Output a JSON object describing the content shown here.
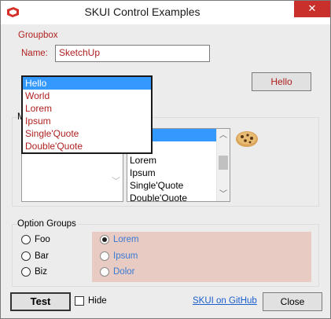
{
  "window": {
    "title": "SKUI Control Examples",
    "close_glyph": "✕",
    "app_icon": "sketchup-icon"
  },
  "groupbox": {
    "label": "Groupbox",
    "name_label": "Name:",
    "name_value": "SketchUp",
    "hello_button": "Hello"
  },
  "dropdown": {
    "options": [
      "Hello",
      "World",
      "Lorem",
      "Ipsum",
      "Single'Quote",
      "Double'Quote"
    ],
    "selected": "Hello"
  },
  "listbox_group": {
    "label": "M",
    "right_list": {
      "items": [
        "",
        "",
        "Lorem",
        "Ipsum",
        "Single'Quote",
        "Double'Quote"
      ]
    },
    "image": "cookie-image"
  },
  "option_groups": {
    "label": "Option Groups",
    "left": [
      "Foo",
      "Bar",
      "Biz"
    ],
    "right": [
      "Lorem",
      "Ipsum",
      "Dolor"
    ],
    "right_selected": "Lorem",
    "panel_color": "#e8cbc3"
  },
  "footer": {
    "test_button": "Test",
    "hide_label": "Hide",
    "github_link": "SKUI on GitHub",
    "close_button": "Close"
  },
  "colors": {
    "accent_red": "#b02020",
    "selection_blue": "#3399ff",
    "link_blue": "#1b5fcf",
    "close_red": "#c9302c"
  }
}
